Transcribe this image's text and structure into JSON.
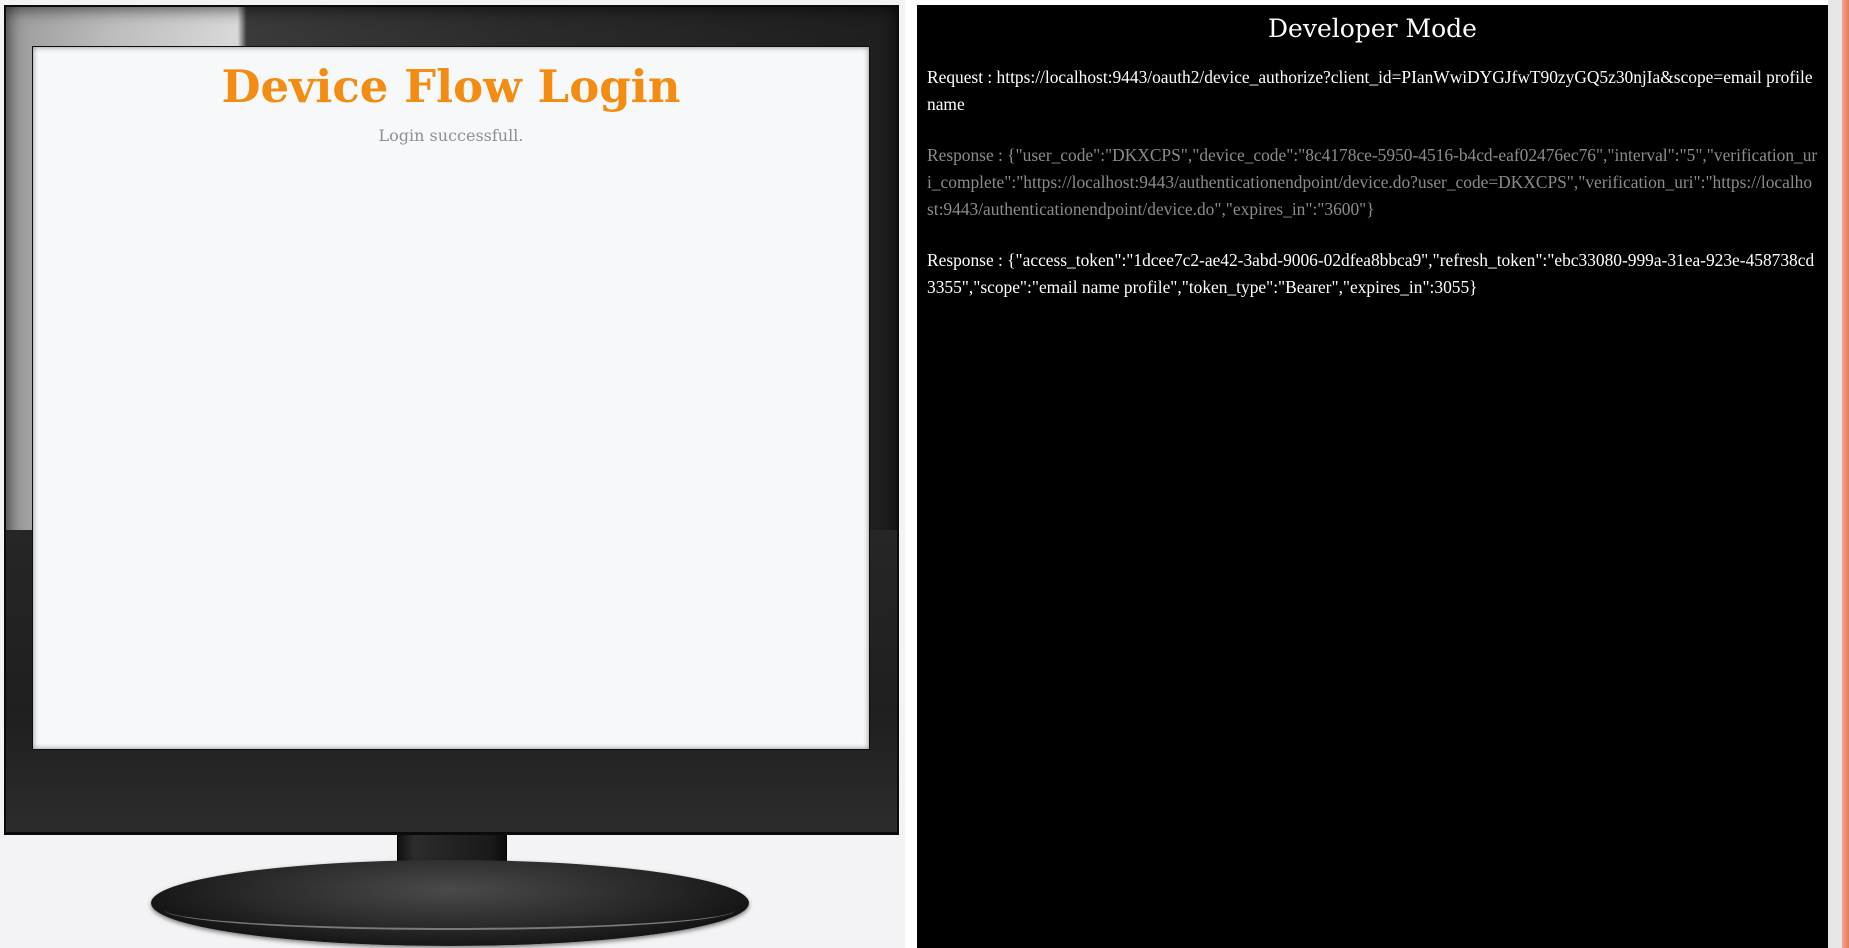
{
  "device_screen": {
    "title": "Device Flow Login",
    "status": "Login successfull."
  },
  "developer_panel": {
    "title": "Developer Mode",
    "logs": [
      {
        "type": "request",
        "text": "Request : https://localhost:9443/oauth2/device_authorize?client_id=PIanWwiDYGJfwT90zyGQ5z30njIa&scope=email profile name"
      },
      {
        "type": "response",
        "text": "Response : {\"user_code\":\"DKXCPS\",\"device_code\":\"8c4178ce-5950-4516-b4cd-eaf02476ec76\",\"interval\":\"5\",\"verification_uri_complete\":\"https://localhost:9443/authenticationendpoint/device.do?user_code=DKXCPS\",\"verification_uri\":\"https://localhost:9443/authenticationendpoint/device.do\",\"expires_in\":\"3600\"}"
      },
      {
        "type": "response",
        "text": "Response : {\"access_token\":\"1dcee7c2-ae42-3abd-9006-02dfea8bbca9\",\"refresh_token\":\"ebc33080-999a-31ea-923e-458738cd3355\",\"scope\":\"email name profile\",\"token_type\":\"Bearer\",\"expires_in\":3055}"
      }
    ]
  },
  "colors": {
    "title_orange": "#f28c12",
    "status_gray": "#8a8f98",
    "panel_bg": "#000000",
    "log_active": "#ffffff",
    "log_dim": "#8b8b8b",
    "edge_accent": "#e9785d"
  }
}
